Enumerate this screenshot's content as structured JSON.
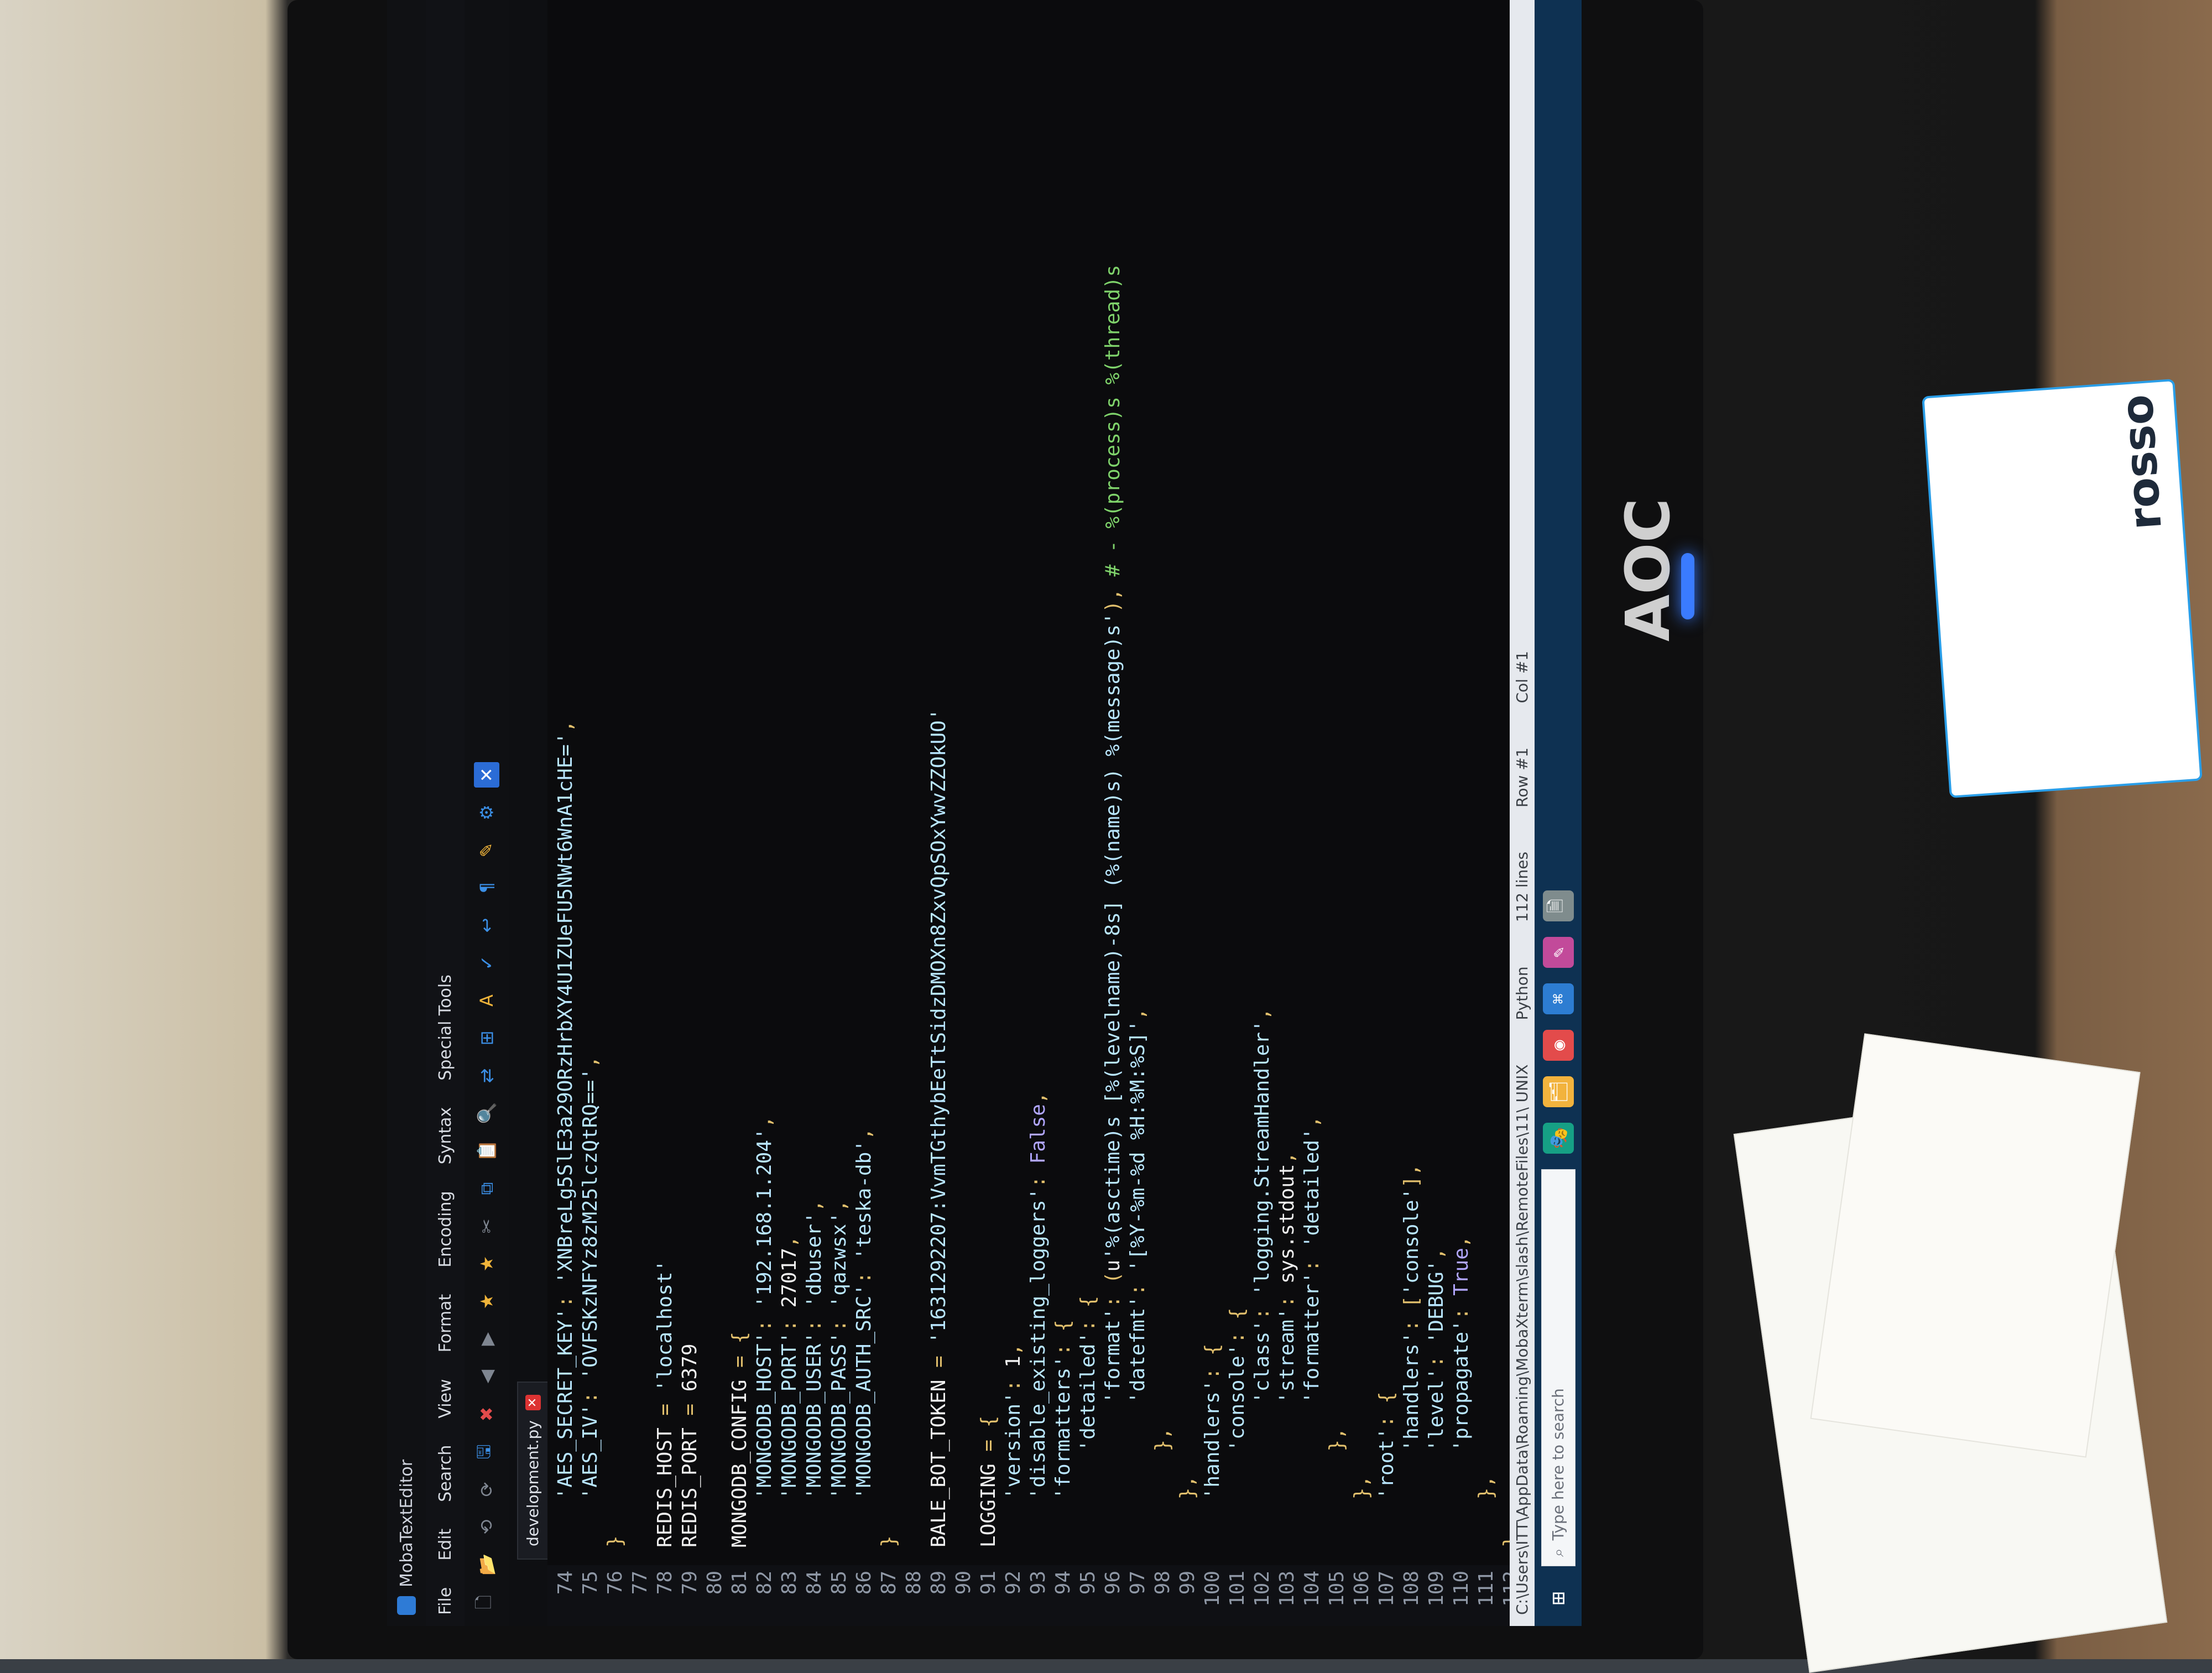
{
  "app": {
    "title": "MobaTextEditor",
    "menus": [
      "File",
      "Edit",
      "Search",
      "View",
      "Format",
      "Encoding",
      "Syntax",
      "Special Tools"
    ],
    "tab": {
      "label": "development.py"
    }
  },
  "toolbar": {
    "buttons": [
      {
        "name": "new-file-icon",
        "glyph": "🗋",
        "tone": "gray"
      },
      {
        "name": "open-folder-icon",
        "glyph": "📂",
        "tone": "gold"
      },
      {
        "name": "undo-icon",
        "glyph": "⟲",
        "tone": "gray"
      },
      {
        "name": "redo-icon",
        "glyph": "⟳",
        "tone": "gray"
      },
      {
        "name": "save-icon",
        "glyph": "🖫",
        "tone": "blue"
      },
      {
        "name": "close-file-icon",
        "glyph": "✖",
        "tone": "red"
      },
      {
        "name": "bookmark-prev-icon",
        "glyph": "◀",
        "tone": "gray"
      },
      {
        "name": "bookmark-next-icon",
        "glyph": "▶",
        "tone": "gray"
      },
      {
        "name": "star-add-icon",
        "glyph": "★",
        "tone": "gold"
      },
      {
        "name": "star-icon",
        "glyph": "★",
        "tone": "gold"
      },
      {
        "name": "cut-icon",
        "glyph": "✂",
        "tone": "gray"
      },
      {
        "name": "copy-icon",
        "glyph": "⧉",
        "tone": "blue"
      },
      {
        "name": "paste-icon",
        "glyph": "📋",
        "tone": "blue"
      },
      {
        "name": "find-icon",
        "glyph": "🔍",
        "tone": "blue"
      },
      {
        "name": "replace-icon",
        "glyph": "⇄",
        "tone": "blue"
      },
      {
        "name": "windows-icon",
        "glyph": "⊞",
        "tone": "blue"
      },
      {
        "name": "text-color-icon",
        "glyph": "A",
        "tone": "gold"
      },
      {
        "name": "spell-icon",
        "glyph": "✓",
        "tone": "blue"
      },
      {
        "name": "wrap-icon",
        "glyph": "↩",
        "tone": "blue"
      },
      {
        "name": "pilcrow-icon",
        "glyph": "¶",
        "tone": "blue"
      },
      {
        "name": "highlight-icon",
        "glyph": "✎",
        "tone": "gold"
      },
      {
        "name": "settings-icon",
        "glyph": "⚙",
        "tone": "blue"
      },
      {
        "name": "close-icon",
        "glyph": "✕",
        "tone": "blue"
      }
    ]
  },
  "editor": {
    "lines": [
      {
        "n": "74",
        "t": "    'AES_SECRET_KEY': 'XNBreLg5SlE3a29ORzHrbXY4U1ZUeFU5NWt6WnA1cHE=',"
      },
      {
        "n": "75",
        "t": "    'AES_IV': 'OVFSKzNFYz8zM25lczQtRQ==',"
      },
      {
        "n": "76",
        "t": "}"
      },
      {
        "n": "77",
        "t": ""
      },
      {
        "n": "78",
        "t": "REDIS_HOST = 'localhost'"
      },
      {
        "n": "79",
        "t": "REDIS_PORT = 6379"
      },
      {
        "n": "80",
        "t": ""
      },
      {
        "n": "81",
        "t": "MONGODB_CONFIG = {"
      },
      {
        "n": "82",
        "t": "    'MONGODB_HOST': '192.168.1.204',"
      },
      {
        "n": "83",
        "t": "    'MONGODB_PORT': 27017,"
      },
      {
        "n": "84",
        "t": "    'MONGODB_USER': 'dbuser',"
      },
      {
        "n": "85",
        "t": "    'MONGODB_PASS': 'qazwsx',"
      },
      {
        "n": "86",
        "t": "    'MONGODB_AUTH_SRC': 'teska-db',"
      },
      {
        "n": "87",
        "t": "}"
      },
      {
        "n": "88",
        "t": ""
      },
      {
        "n": "89",
        "t": "BALE_BOT_TOKEN = '1631292207:VvmTGthybEeTtSidzDMOXn8ZxvQpSOxYwvZZOkUO'"
      },
      {
        "n": "90",
        "t": ""
      },
      {
        "n": "91",
        "t": "LOGGING = {"
      },
      {
        "n": "92",
        "t": "    'version': 1,"
      },
      {
        "n": "93",
        "t": "    'disable_existing_loggers': False,"
      },
      {
        "n": "94",
        "t": "    'formatters': {"
      },
      {
        "n": "95",
        "t": "        'detailed': {"
      },
      {
        "n": "96",
        "t": "            'format': (u'%(asctime)s [%(levelname)-8s] (%(name)s) %(message)s'), # - %(process)s %(thread)s"
      },
      {
        "n": "97",
        "t": "            'datefmt': '[%Y-%m-%d %H:%M:%S]',"
      },
      {
        "n": "98",
        "t": "        },"
      },
      {
        "n": "99",
        "t": "    },"
      },
      {
        "n": "100",
        "t": "    'handlers': {"
      },
      {
        "n": "101",
        "t": "        'console': {"
      },
      {
        "n": "102",
        "t": "            'class': 'logging.StreamHandler',"
      },
      {
        "n": "103",
        "t": "            'stream': sys.stdout,"
      },
      {
        "n": "104",
        "t": "            'formatter': 'detailed',"
      },
      {
        "n": "105",
        "t": "        },"
      },
      {
        "n": "106",
        "t": "    },"
      },
      {
        "n": "107",
        "t": "    'root': {"
      },
      {
        "n": "108",
        "t": "        'handlers': ['console'],"
      },
      {
        "n": "109",
        "t": "        'level': 'DEBUG',"
      },
      {
        "n": "110",
        "t": "        'propagate': True,"
      },
      {
        "n": "111",
        "t": "    },"
      },
      {
        "n": "112",
        "t": "}"
      }
    ]
  },
  "status": {
    "path": "C:\\Users\\ITT\\AppData\\Roaming\\MobaXterm\\slash\\RemoteFiles\\11\\ UNIX",
    "language": "Python",
    "lines": "112 lines",
    "row": "Row #1",
    "col": "Col #1"
  },
  "taskbar": {
    "search_placeholder": "Type here to search"
  },
  "scene": {
    "monitor_brand": "AOC",
    "sticker_brand": "rosso"
  },
  "colors": {
    "accent": "#2b6cd6",
    "taskbar": "#0e3152",
    "power_led": "#3a7bff"
  }
}
